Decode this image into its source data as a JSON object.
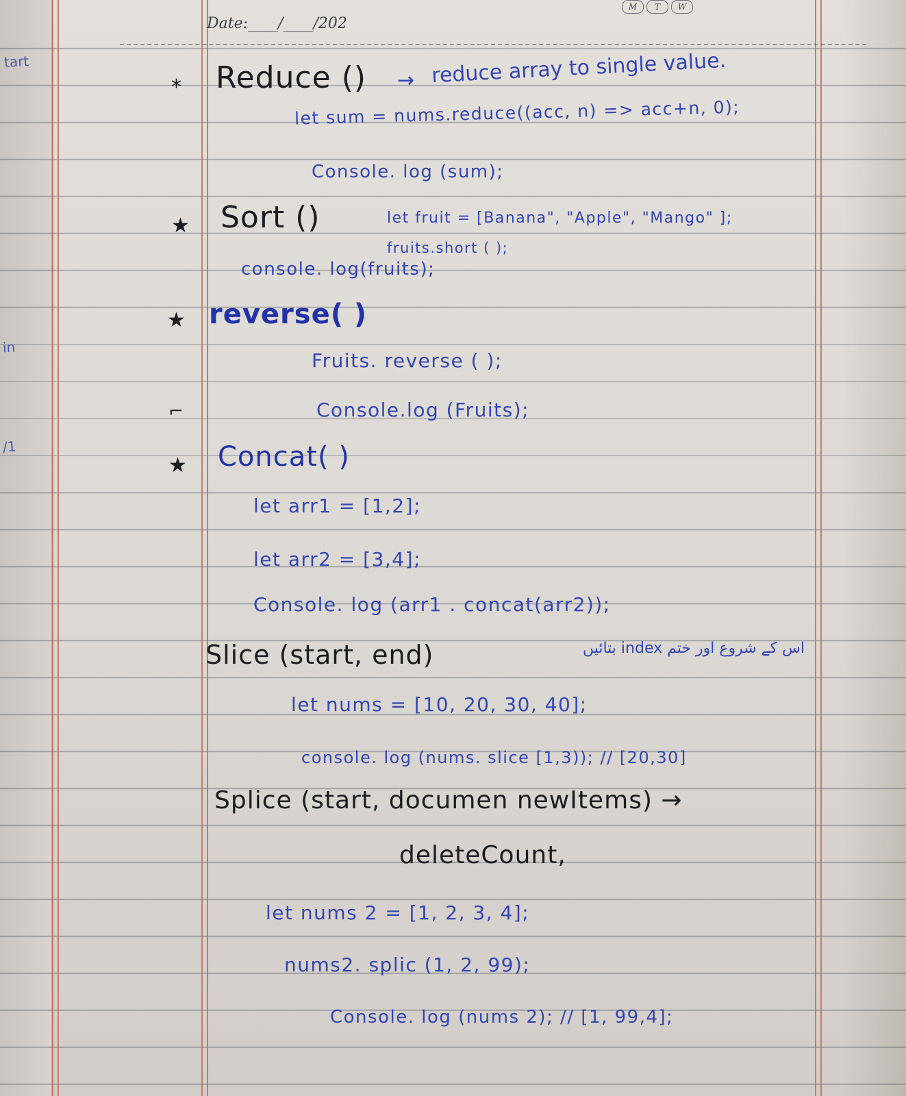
{
  "header": {
    "date_label": "Date:____/____/202",
    "day_boxes": [
      "M",
      "T",
      "W"
    ]
  },
  "margin": {
    "notes": [
      "tart",
      "in",
      "/1"
    ]
  },
  "sections": {
    "reduce": {
      "star": "*",
      "title": "Reduce ()",
      "arrow": "→",
      "description": "reduce array to single value.",
      "lines": [
        "let sum = nums.reduce((acc, n) => acc+n, 0);",
        "Console. log (sum);"
      ]
    },
    "sort": {
      "star": "★",
      "title": "Sort ()",
      "lines": [
        "let fruit = [Banana\", \"Apple\", \"Mango\" ];",
        "fruits.short ( );",
        "console. log(fruits);"
      ]
    },
    "reverse": {
      "star": "★",
      "title": "reverse( )",
      "lines": [
        "Fruits. reverse ( );",
        "Console.log (Fruits);"
      ],
      "side_mark": "⌐"
    },
    "concat": {
      "star": "★",
      "title": "Concat( )",
      "lines": [
        "let arr1 = [1,2];",
        "let arr2 = [3,4];",
        "Console. log (arr1 . concat(arr2));"
      ]
    },
    "slice": {
      "title": "Slice (start, end)",
      "note": "اس کے شروع اور ختم index بتائیں",
      "lines": [
        "let nums = [10, 20, 30, 40];",
        "console. log (nums. slice [1,3)); // [20,30]"
      ]
    },
    "splice": {
      "title": "Splice (start, documen newItems) →",
      "subtitle": "deleteCount,",
      "lines": [
        "let nums 2 = [1, 2, 3, 4];",
        "nums2. splic (1, 2, 99);",
        "Console. log (nums 2);   // [1, 99,4];"
      ]
    }
  }
}
